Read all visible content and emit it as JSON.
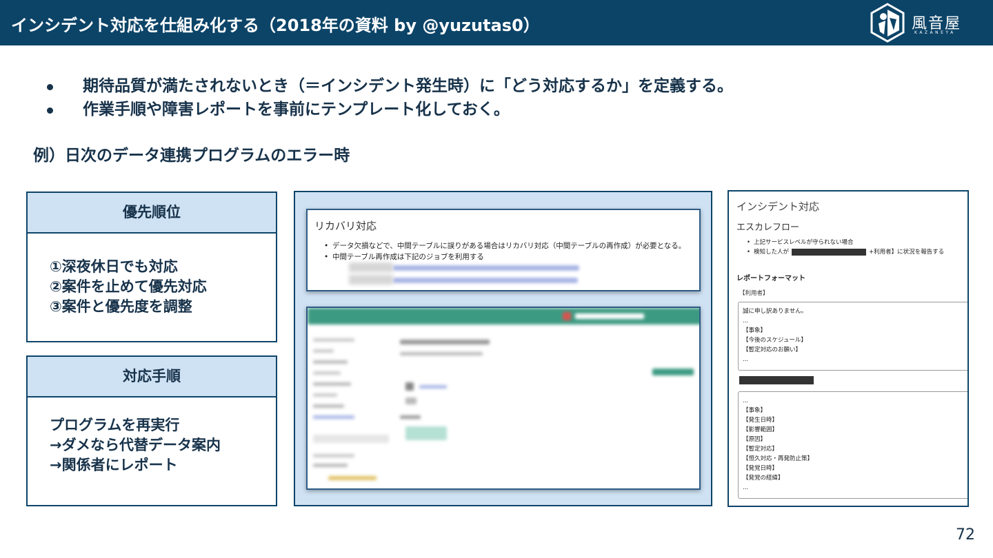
{
  "header": {
    "title": "インシデント対応を仕組み化する（2018年の資料 by @yuzutas0）",
    "logo_text": "風音屋",
    "logo_sub": "KAZANEYA"
  },
  "bullets": [
    "期待品質が満たされないとき（＝インシデント発生時）に「どう対応するか」を定義する。",
    "作業手順や障害レポートを事前にテンプレート化しておく。"
  ],
  "example_heading": "例）日次のデータ連携プログラムのエラー時",
  "priority_box": {
    "title": "優先順位",
    "lines": [
      "①深夜休日でも対応",
      "②案件を止めて優先対応",
      "③案件と優先度を調整"
    ]
  },
  "procedure_box": {
    "title": "対応手順",
    "lines": [
      "プログラムを再実行",
      "→ダメなら代替データ案内",
      "→関係者にレポート"
    ]
  },
  "recovery_doc": {
    "title": "リカバリ対応",
    "items": [
      "データ欠損などで、中間テーブルに誤りがある場合はリカバリ対応（中間テーブルの再作成）が必要となる。",
      "中間テーブル再作成は下記のジョブを利用する"
    ]
  },
  "incident_doc": {
    "title": "インシデント対応",
    "subtitle": "エスカレフロー",
    "items": [
      {
        "before": "上記サービスレベルが守られない場合",
        "after": ""
      },
      {
        "before": "検知した人が",
        "after": "+利用者】に状況を報告する"
      }
    ],
    "report_heading": "レポートフォーマット",
    "user_label": "【利用者】",
    "box1_lines": [
      "誠に申し訳ありません。",
      "...",
      "【事象】",
      "【今後のスケジュール】",
      "【暫定対応のお願い】",
      "..."
    ],
    "box2_lines": [
      "...",
      "【事象】",
      "【発生日時】",
      "【影響範囲】",
      "【原因】",
      "【暫定対応】",
      "【恒久対応・再発防止策】",
      "【発覚日時】",
      "【発覚の経緯】",
      "..."
    ]
  },
  "page_number": "72",
  "colors": {
    "header_bg": "#0c4468",
    "box_head_bg": "#cfe2f3",
    "text": "#17324a",
    "blur_link": "#aab7e6",
    "blur_bar": "#3d9a82"
  }
}
